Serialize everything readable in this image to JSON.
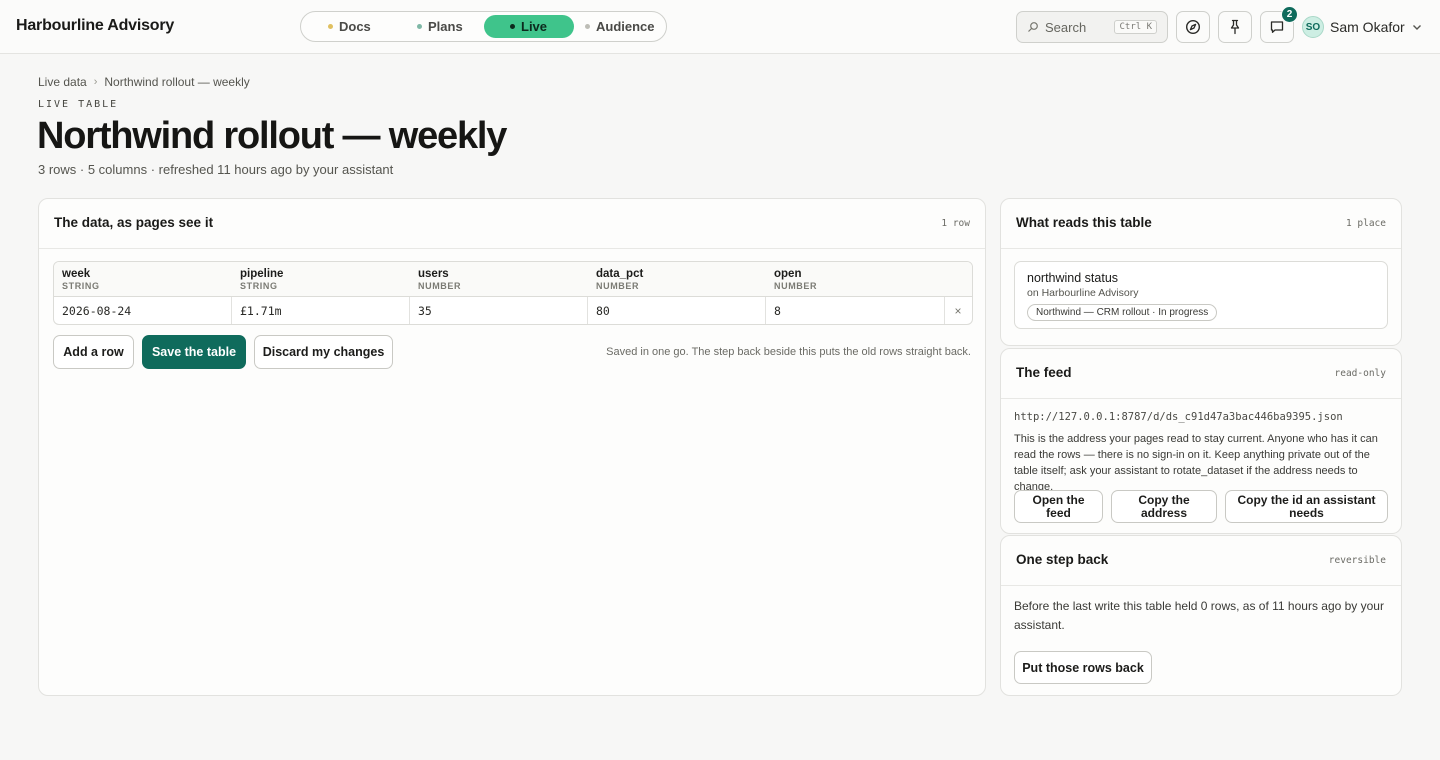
{
  "brand": "Harbourline Advisory",
  "nav": {
    "tabs": [
      {
        "label": "Docs",
        "dot": "#e0c060"
      },
      {
        "label": "Plans",
        "dot": "#7fb8a6"
      },
      {
        "label": "Live",
        "dot": "#0c2a1d",
        "active": true
      },
      {
        "label": "Audience",
        "dot": "#bdbdb6"
      }
    ]
  },
  "search": {
    "label": "Search",
    "shortcut": "Ctrl K"
  },
  "notifications": {
    "count": "2"
  },
  "user": {
    "initials": "SO",
    "name": "Sam Okafor"
  },
  "breadcrumb": {
    "root": "Live data",
    "current": "Northwind rollout — weekly"
  },
  "page": {
    "eyebrow": "LIVE TABLE",
    "title": "Northwind rollout — weekly",
    "meta": "3 rows · 5 columns · refreshed 11 hours ago by your assistant"
  },
  "data_card": {
    "title": "The data, as pages see it",
    "tag": "1 row",
    "columns": [
      {
        "name": "week",
        "type": "STRING"
      },
      {
        "name": "pipeline",
        "type": "STRING"
      },
      {
        "name": "users",
        "type": "NUMBER"
      },
      {
        "name": "data_pct",
        "type": "NUMBER"
      },
      {
        "name": "open",
        "type": "NUMBER"
      }
    ],
    "rows": [
      [
        "2026-08-24",
        "£1.71m",
        "35",
        "80",
        "8"
      ]
    ],
    "delete_glyph": "×",
    "add_label": "Add a row",
    "save_label": "Save the table",
    "discard_label": "Discard my changes",
    "note": "Saved in one go. The step back beside this puts the old rows straight back."
  },
  "reads_card": {
    "title": "What reads this table",
    "tag": "1 place",
    "item_title": "northwind status",
    "item_sub": "on Harbourline Advisory",
    "item_chip": "Northwind — CRM rollout · In progress"
  },
  "feed_card": {
    "title": "The feed",
    "tag": "read-only",
    "url": "http://127.0.0.1:8787/d/ds_c91d47a3bac446ba9395.json",
    "text": "This is the address your pages read to stay current. Anyone who has it can read the rows — there is no sign-in on it. Keep anything private out of the table itself; ask your assistant to rotate_dataset if the address needs to change.",
    "open_label": "Open the feed",
    "copy_label": "Copy the address",
    "copy_id_label": "Copy the id an assistant needs"
  },
  "back_card": {
    "title": "One step back",
    "tag": "reversible",
    "text": "Before the last write this table held 0 rows, as of 11 hours ago by your assistant.",
    "button_label": "Put those rows back"
  }
}
